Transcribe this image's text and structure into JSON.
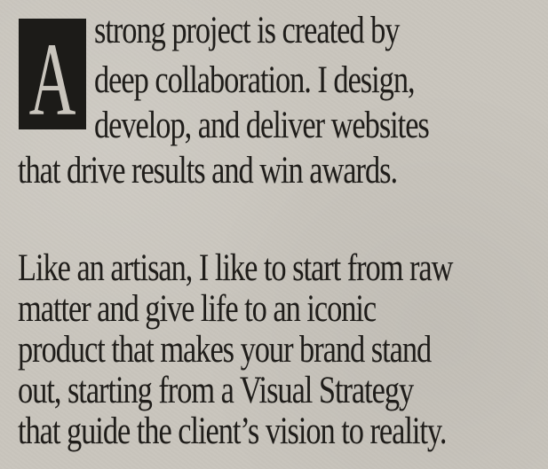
{
  "intro": {
    "drop_cap": "A",
    "lines": [
      "strong project is created by",
      "deep collaboration. I design,",
      "develop, and deliver websites",
      "that drive results and win awards."
    ]
  },
  "body": {
    "lines": [
      "Like an artisan, I like to start from raw",
      "matter and give life to an iconic",
      "product that makes your brand stand",
      "out, starting from a Visual Strategy",
      "that guide the client’s vision to reality."
    ]
  },
  "colors": {
    "background": "#c9c5bd",
    "text": "#1f1d1a",
    "drop_cap_box": "#1c1b18",
    "drop_cap_letter": "#c9c5bd"
  }
}
